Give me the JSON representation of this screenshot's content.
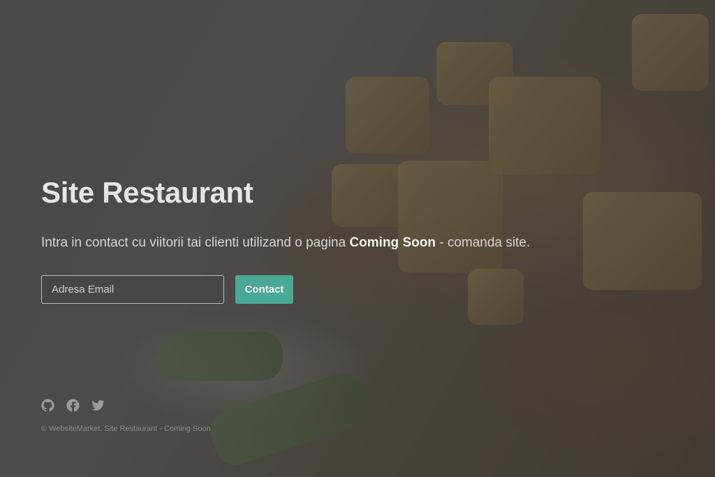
{
  "hero": {
    "title": "Site Restaurant",
    "subtitle_before": "Intra in contact cu viitorii tai clienti utilizand o pagina ",
    "subtitle_bold": "Coming Soon",
    "subtitle_after": " - comanda site."
  },
  "form": {
    "email_placeholder": "Adresa Email",
    "email_value": "",
    "submit_label": "Contact"
  },
  "social": [
    {
      "icon": "github-icon"
    },
    {
      "icon": "facebook-icon"
    },
    {
      "icon": "twitter-icon"
    }
  ],
  "footer": {
    "text": "© WebsiteMarket. Site Restaurant - Coming Soon"
  },
  "colors": {
    "accent": "#4aa896",
    "overlay": "#2d2d2d"
  }
}
